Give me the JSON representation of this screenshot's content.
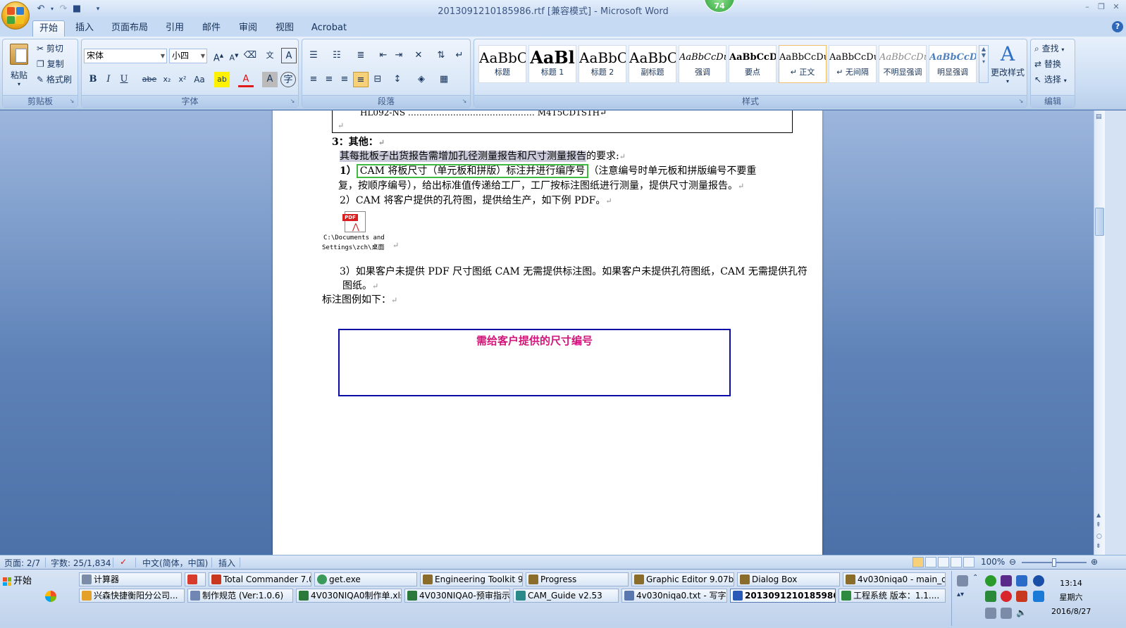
{
  "window": {
    "title": "2013091210185986.rtf [兼容模式] - Microsoft Word",
    "badge": "74"
  },
  "tabs": [
    "开始",
    "插入",
    "页面布局",
    "引用",
    "邮件",
    "审阅",
    "视图",
    "Acrobat"
  ],
  "ribbon": {
    "clipboard": {
      "paste": "粘贴",
      "cut": "剪切",
      "copy": "复制",
      "format_painter": "格式刷",
      "label": "剪贴板"
    },
    "font": {
      "name": "宋体",
      "size": "小四",
      "label": "字体"
    },
    "paragraph": {
      "label": "段落"
    },
    "styles": {
      "label": "样式",
      "change": "更改样式",
      "items": [
        {
          "sample": "AaBbC(",
          "name": "标题"
        },
        {
          "sample": "AaBl",
          "name": "标题 1"
        },
        {
          "sample": "AaBbC(",
          "name": "标题 2"
        },
        {
          "sample": "AaBbC(",
          "name": "副标题"
        },
        {
          "sample": "AaBbCcDι",
          "name": "强调"
        },
        {
          "sample": "AaBbCcD",
          "name": "要点"
        },
        {
          "sample": "AaBbCcDι",
          "name": "↵ 正文"
        },
        {
          "sample": "AaBbCcDι",
          "name": "↵ 无间隔"
        },
        {
          "sample": "AaBbCcDι",
          "name": "不明显强调"
        },
        {
          "sample": "AaBbCcDι",
          "name": "明显强调"
        }
      ]
    },
    "editing": {
      "find": "查找",
      "replace": "替换",
      "select": "选择",
      "label": "编辑"
    }
  },
  "document": {
    "top_text": "HL092-NS ……………………………………… M4T5CD1S1H↵",
    "section_heading": "3：其他：",
    "highlighted": "其每批板子出货报告需增加孔径测量报告和尺寸测量报告",
    "line1_rest": "的要求:",
    "item1_num": "1）",
    "item1_boxed": "CAM 将板尺寸（单元板和拼版）标注并进行编序号",
    "item1_rest": "（注意编号时单元板和拼版编号不要重",
    "item1_line2": "复，按顺序编号），给出标准值传递给工厂，工厂按标注图纸进行测量，提供尺寸测量报告。",
    "item2": "2）CAM 将客户提供的孔符图，提供给生产，如下例 PDF。",
    "pdf_label_1": "C:\\Documents and",
    "pdf_label_2": "Settings\\zch\\桌面",
    "item3_line1": "3）如果客户未提供 PDF 尺寸图纸 CAM 无需提供标注图。如果客户未提供孔符图纸，CAM 无需提供孔符",
    "item3_line2": "图纸。",
    "example_heading": "标注图例如下：",
    "boxed_title": "需给客户提供的尺寸编号"
  },
  "statusbar": {
    "page": "页面: 2/7",
    "words": "字数: 25/1,834",
    "language": "中文(简体，中国)",
    "mode": "插入",
    "zoom": "100%"
  },
  "taskbar": {
    "start": "开始",
    "row1": [
      "计算器",
      "",
      "Total Commander 7.0 ...",
      "get.exe",
      "Engineering Toolkit 9.0...",
      "Progress",
      "Graphic Editor 9.07b2 ...",
      "Dialog Box",
      "4v030niqa0 - main_qa"
    ],
    "row2": [
      "兴森快捷衡阳分公司...",
      "制作规范 (Ver:1.0.6)",
      "4V030NIQA0制作单.xls...",
      "4V030NIQA0-预审指示...",
      "CAM_Guide v2.53",
      "4v030niqa0.txt - 写字板",
      "2013091210185986....",
      "工程系统   版本：1.1...."
    ],
    "clock_time": "13:14",
    "clock_day": "星期六",
    "clock_date": "2016/8/27"
  },
  "colors": {
    "highlight": "#c9c9d9",
    "green_box": "#3fb93f",
    "blue_box": "#0a0aa8",
    "pink_title": "#d4147a"
  }
}
